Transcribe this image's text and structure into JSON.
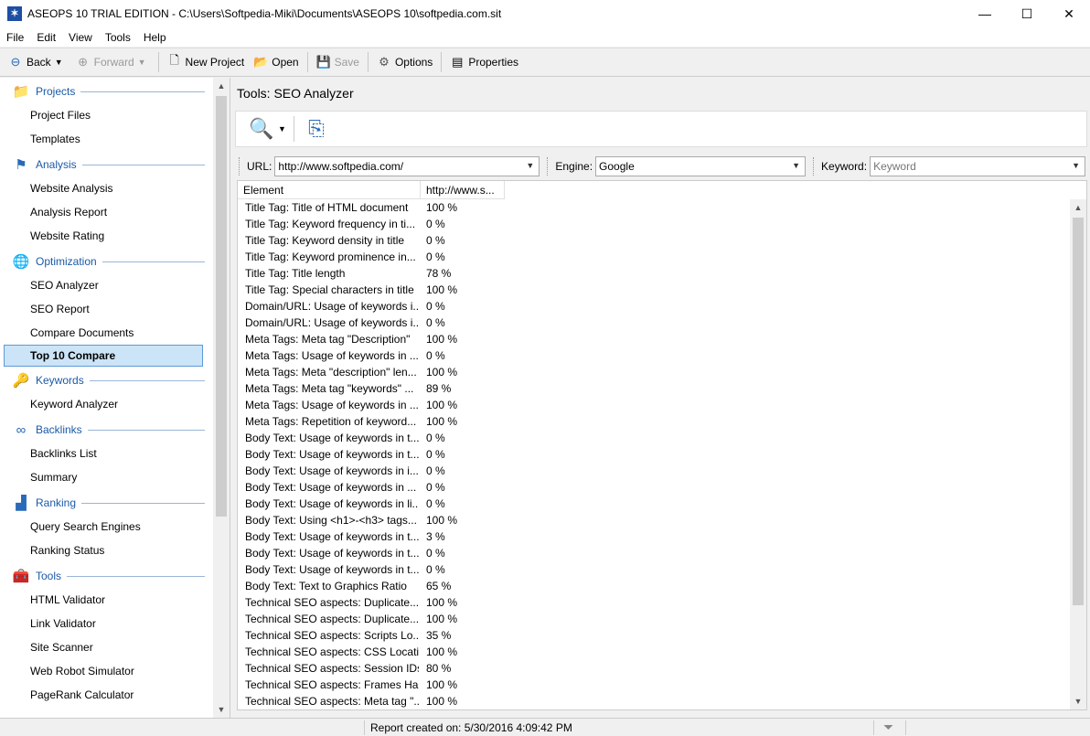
{
  "window": {
    "title": "ASEOPS 10 TRIAL EDITION - C:\\Users\\Softpedia-Miki\\Documents\\ASEOPS 10\\softpedia.com.sit",
    "minimize": "—",
    "maximize": "☐",
    "close": "✕"
  },
  "menu": [
    "File",
    "Edit",
    "View",
    "Tools",
    "Help"
  ],
  "toolbar": {
    "back": "Back",
    "forward": "Forward",
    "new_project": "New Project",
    "open": "Open",
    "save": "Save",
    "options": "Options",
    "properties": "Properties"
  },
  "sidebar": {
    "groups": [
      {
        "label": "Projects",
        "icon": "folder-icon",
        "items": [
          "Project Files",
          "Templates"
        ]
      },
      {
        "label": "Analysis",
        "icon": "analysis-icon",
        "items": [
          "Website Analysis",
          "Analysis Report",
          "Website Rating"
        ]
      },
      {
        "label": "Optimization",
        "icon": "globe-icon",
        "items": [
          "SEO Analyzer",
          "SEO Report",
          "Compare Documents",
          "Top 10 Compare"
        ]
      },
      {
        "label": "Keywords",
        "icon": "key-icon",
        "items": [
          "Keyword Analyzer"
        ]
      },
      {
        "label": "Backlinks",
        "icon": "link-icon",
        "items": [
          "Backlinks List",
          "Summary"
        ]
      },
      {
        "label": "Ranking",
        "icon": "ranking-icon",
        "items": [
          "Query Search Engines",
          "Ranking Status"
        ]
      },
      {
        "label": "Tools",
        "icon": "tools-icon",
        "items": [
          "HTML Validator",
          "Link Validator",
          "Site Scanner",
          "Web Robot Simulator",
          "PageRank Calculator"
        ]
      }
    ],
    "selected": "Top 10 Compare"
  },
  "main": {
    "title": "Tools: SEO Analyzer",
    "url_label": "URL:",
    "url_value": "http://www.softpedia.com/",
    "engine_label": "Engine:",
    "engine_value": "Google",
    "keyword_label": "Keyword:",
    "keyword_placeholder": "Keyword"
  },
  "grid": {
    "headers": [
      "Element",
      "http://www.s..."
    ],
    "rows": [
      [
        "Title Tag: Title of HTML document",
        "100 %"
      ],
      [
        "Title Tag: Keyword frequency in ti...",
        "0 %"
      ],
      [
        "Title Tag: Keyword density in title",
        "0 %"
      ],
      [
        "Title Tag: Keyword prominence in...",
        "0 %"
      ],
      [
        "Title Tag: Title length",
        "78 %"
      ],
      [
        "Title Tag: Special characters in title",
        "100 %"
      ],
      [
        "Domain/URL: Usage of keywords i...",
        "0 %"
      ],
      [
        "Domain/URL: Usage of keywords i...",
        "0 %"
      ],
      [
        "Meta Tags: Meta tag \"Description\"",
        "100 %"
      ],
      [
        "Meta Tags: Usage of keywords in ...",
        "0 %"
      ],
      [
        "Meta Tags: Meta \"description\" len...",
        "100 %"
      ],
      [
        "Meta Tags: Meta tag \"keywords\" ...",
        "89 %"
      ],
      [
        "Meta Tags: Usage of keywords in ...",
        "100 %"
      ],
      [
        "Meta Tags: Repetition of keyword...",
        "100 %"
      ],
      [
        "Body Text: Usage of keywords in t...",
        "0 %"
      ],
      [
        "Body Text: Usage of keywords in t...",
        "0 %"
      ],
      [
        "Body Text: Usage of keywords in i...",
        "0 %"
      ],
      [
        "Body Text: Usage of keywords in ...",
        "0 %"
      ],
      [
        "Body Text: Usage of keywords in li...",
        "0 %"
      ],
      [
        "Body Text: Using <h1>-<h3> tags...",
        "100 %"
      ],
      [
        "Body Text: Usage of keywords in t...",
        "3 %"
      ],
      [
        "Body Text: Usage of keywords in t...",
        "0 %"
      ],
      [
        "Body Text: Usage of keywords in t...",
        "0 %"
      ],
      [
        "Body Text: Text to Graphics Ratio",
        "65 %"
      ],
      [
        "Technical SEO aspects: Duplicate...",
        "100 %"
      ],
      [
        "Technical SEO aspects: Duplicate...",
        "100 %"
      ],
      [
        "Technical SEO aspects: Scripts Lo...",
        "35 %"
      ],
      [
        "Technical SEO aspects: CSS Locati...",
        "100 %"
      ],
      [
        "Technical SEO aspects: Session IDs",
        "80 %"
      ],
      [
        "Technical SEO aspects: Frames Ha...",
        "100 %"
      ],
      [
        "Technical SEO aspects: Meta tag \"...",
        "100 %"
      ]
    ]
  },
  "status": {
    "text": "Report created on: 5/30/2016 4:09:42 PM"
  }
}
